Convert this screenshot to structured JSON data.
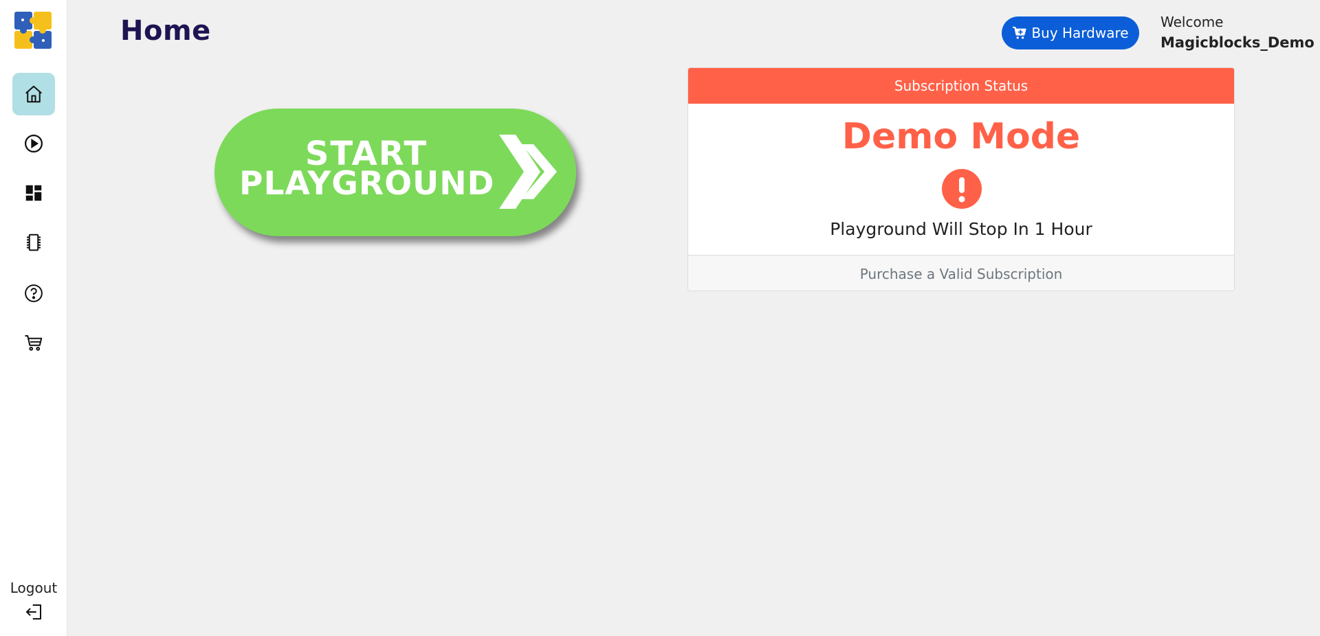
{
  "header": {
    "title": "Home",
    "buy_button_label": "Buy Hardware",
    "welcome_label": "Welcome",
    "username": "Magicblocks_Demo"
  },
  "sidebar": {
    "items": [
      {
        "name": "home",
        "icon": "home-icon",
        "active": true
      },
      {
        "name": "play",
        "icon": "play-circle-icon",
        "active": false
      },
      {
        "name": "dashboard",
        "icon": "dashboard-icon",
        "active": false
      },
      {
        "name": "devices",
        "icon": "device-chip-icon",
        "active": false
      },
      {
        "name": "help",
        "icon": "help-circle-icon",
        "active": false
      },
      {
        "name": "cart",
        "icon": "cart-icon",
        "active": false
      }
    ],
    "logout_label": "Logout"
  },
  "start_button": {
    "line1": "START",
    "line2": "PLAYGROUND"
  },
  "subscription": {
    "header": "Subscription Status",
    "mode": "Demo Mode",
    "message": "Playground Will Stop In 1 Hour",
    "footer": "Purchase a Valid Subscription"
  },
  "colors": {
    "accent": "#0b5ed7",
    "alert": "#ff6148",
    "active_nav": "#b0dfe5",
    "start_green": "#7dd95a",
    "title": "#1f1452"
  }
}
